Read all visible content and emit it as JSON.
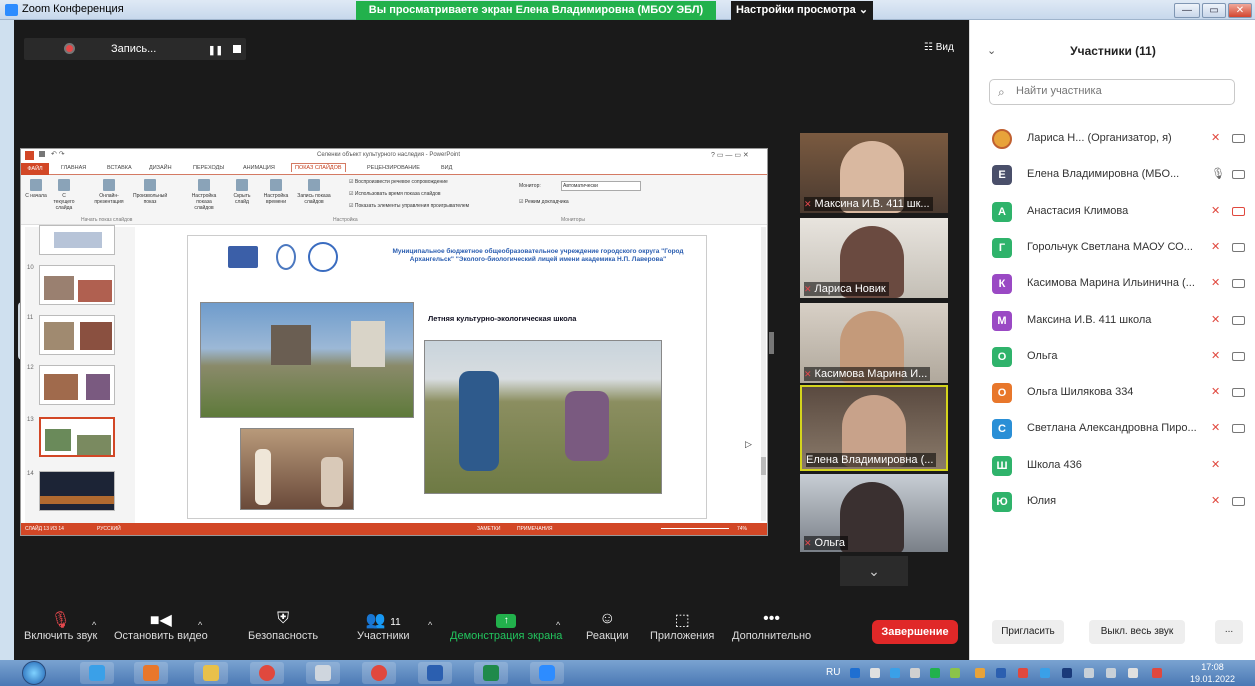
{
  "window": {
    "title": "Zoom Конференция",
    "share_banner": "Вы просматриваете экран Елена Владимировна (МБОУ ЭБЛ)",
    "view_settings": "Настройки просмотра ⌄",
    "minimize": "—",
    "maximize": "▭",
    "close": "✕"
  },
  "recording": {
    "label": "Запись...",
    "pause": "❚❚"
  },
  "view_button": "☷ Вид",
  "ppt": {
    "title": "Селенки объект культурного наследия - PowerPoint",
    "tabs": [
      "ФАЙЛ",
      "ГЛАВНАЯ",
      "ВСТАВКА",
      "ДИЗАЙН",
      "ПЕРЕХОДЫ",
      "АНИМАЦИЯ",
      "ПОКАЗ СЛАЙДОВ",
      "РЕЦЕНЗИРОВАНИЕ",
      "ВИД"
    ],
    "ribbon_buttons": [
      "С начала",
      "С текущего слайда",
      "Онлайн-презентация",
      "Произвольный показ",
      "Настройка показа слайдов",
      "Скрыть слайд",
      "Настройка времени",
      "Запись показа слайдов"
    ],
    "checks": [
      "Воспроизвести речевое сопровождение",
      "Использовать время показа слайдов",
      "Показать элементы управления проигрывателем"
    ],
    "monitor_label": "Монитор:",
    "monitor_value": "Автоматически",
    "presenter_mode": "Режим докладчика",
    "group_start": "Начать показ слайдов",
    "group_setup": "Настройка",
    "group_monitors": "Мониторы",
    "thumb_numbers": [
      "10",
      "11",
      "12",
      "13",
      "14"
    ],
    "slide_school": "Муниципальное бюджетное общеобразовательное учреждение городского округа \"Город Архангельск\" \"Эколого-биологический лицей имени академика Н.П. Лаверова\"",
    "slide_heading": "Летняя культурно-экологическая школа",
    "status_left": "СЛАЙД 13 ИЗ 14",
    "status_lang": "РУССКИЙ",
    "status_notes": "ЗАМЕТКИ",
    "status_comments": "ПРИМЕЧАНИЯ",
    "status_zoom": "74%"
  },
  "tiles": [
    {
      "name": "Максина И.В. 411 шк..."
    },
    {
      "name": "Лариса Новик"
    },
    {
      "name": "Касимова Марина И..."
    },
    {
      "name": "Елена Владимировна (..."
    },
    {
      "name": "Ольга"
    }
  ],
  "scroll_down": "⌄",
  "toolbar": {
    "unmute": "Включить звук",
    "stop_video": "Остановить видео",
    "security": "Безопасность",
    "participants": "Участники",
    "participants_count": "11",
    "share_screen": "Демонстрация экрана",
    "reactions": "Реакции",
    "apps": "Приложения",
    "more": "Дополнительно",
    "end": "Завершение"
  },
  "panel": {
    "title": "Участники (11)",
    "collapse": "⌄",
    "search_placeholder": "Найти участника",
    "participants": [
      {
        "initial": "",
        "name": "Лариса Н...   (Организатор, я)",
        "color": "#e8a33a"
      },
      {
        "initial": "Е",
        "name": "Елена Владимировна (МБО...",
        "color": "#4a4f6a"
      },
      {
        "initial": "А",
        "name": "Анастасия Климова",
        "color": "#2fb36b"
      },
      {
        "initial": "Г",
        "name": "Горольчук Светлана МАОУ СО...",
        "color": "#2fb36b"
      },
      {
        "initial": "К",
        "name": "Касимова Марина Ильинична (...",
        "color": "#9a49c4"
      },
      {
        "initial": "М",
        "name": "Максина И.В. 411 школа",
        "color": "#9a49c4"
      },
      {
        "initial": "О",
        "name": "Ольга",
        "color": "#2fb36b"
      },
      {
        "initial": "О",
        "name": "Ольга Шилякова 334",
        "color": "#e8772b"
      },
      {
        "initial": "С",
        "name": "Светлана Александровна Пиро...",
        "color": "#2a8fd6"
      },
      {
        "initial": "Ш",
        "name": "Школа 436",
        "color": "#2fb36b"
      },
      {
        "initial": "Ю",
        "name": "Юлия",
        "color": "#2fb36b"
      }
    ],
    "invite": "Пригласить",
    "mute_all": "Выкл. весь звук",
    "more": "..."
  },
  "taskbar": {
    "lang": "RU",
    "time": "17:08",
    "date": "19.01.2022"
  }
}
